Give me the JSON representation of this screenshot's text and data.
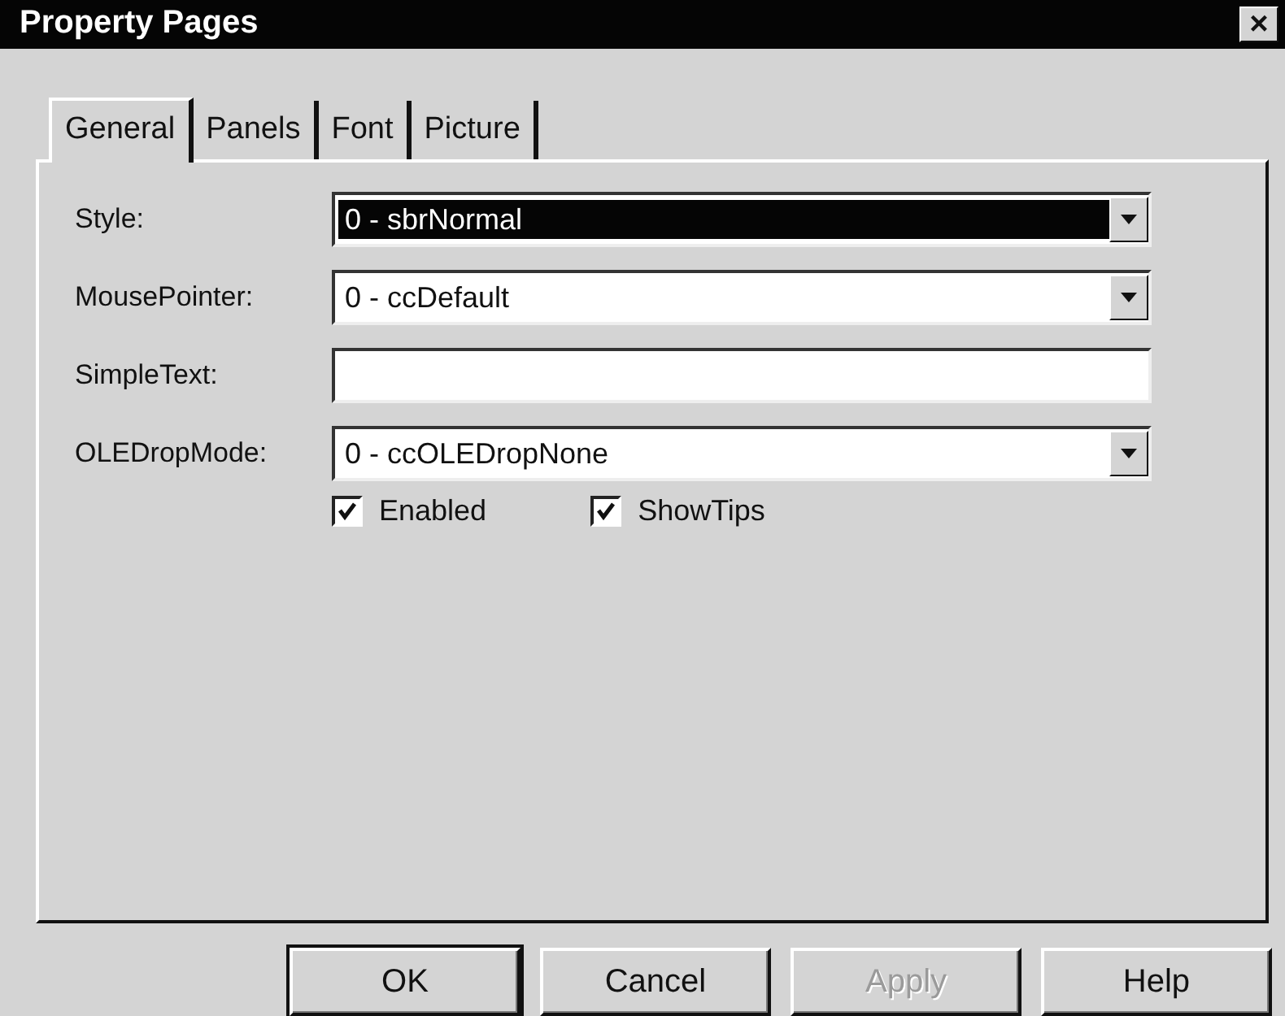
{
  "window": {
    "title": "Property Pages",
    "close": "×"
  },
  "tabs": [
    {
      "label": "General",
      "selected": true
    },
    {
      "label": "Panels",
      "selected": false
    },
    {
      "label": "Font",
      "selected": false
    },
    {
      "label": "Picture",
      "selected": false
    }
  ],
  "fields": [
    {
      "kind": "combo",
      "label": "Style:",
      "value": "0 - sbrNormal",
      "selected": true
    },
    {
      "kind": "combo",
      "label": "MousePointer:",
      "value": "0 - ccDefault",
      "selected": false
    },
    {
      "kind": "text",
      "label": "SimpleText:"
    },
    {
      "kind": "combo",
      "label": "OLEDropMode:",
      "value": "0 - ccOLEDropNone",
      "selected": false
    }
  ],
  "checkboxes": [
    {
      "label": "Enabled",
      "checked": true
    },
    {
      "label": "ShowTips",
      "checked": true
    }
  ],
  "buttons": [
    {
      "label": "OK",
      "disabled": false,
      "default": true
    },
    {
      "label": "Cancel",
      "disabled": false,
      "default": false
    },
    {
      "label": "Apply",
      "disabled": true,
      "default": false
    },
    {
      "label": "Help",
      "disabled": false,
      "default": false
    }
  ]
}
